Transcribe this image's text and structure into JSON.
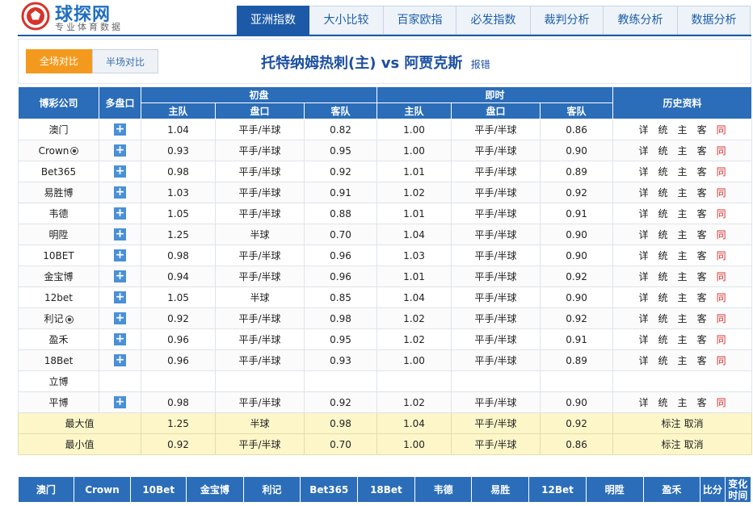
{
  "logo": {
    "name": "球探网",
    "subtitle": "专业体育数据",
    "icon": "soccer-ball-logo"
  },
  "nav": {
    "tabs": [
      {
        "label": "亚洲指数",
        "active": true
      },
      {
        "label": "大小比较",
        "active": false
      },
      {
        "label": "百家欧指",
        "active": false
      },
      {
        "label": "必发指数",
        "active": false
      },
      {
        "label": "裁判分析",
        "active": false
      },
      {
        "label": "教练分析",
        "active": false
      },
      {
        "label": "数据分析",
        "active": false
      }
    ]
  },
  "compare": {
    "full_label": "全场对比",
    "half_label": "半场对比"
  },
  "match": {
    "title": "托特纳姆热刺(主) vs 阿贾克斯",
    "report": "报错"
  },
  "table": {
    "headers": {
      "company": "博彩公司",
      "multi": "多盘口",
      "initial": "初盘",
      "live": "即时",
      "history": "历史资料",
      "home": "主队",
      "line": "盘口",
      "away": "客队"
    },
    "history_links": [
      "详",
      "统",
      "主",
      "客",
      "同"
    ],
    "rows": [
      {
        "company": "澳门",
        "ball": false,
        "plus": true,
        "i_home": "1.04",
        "i_line": "平手/半球",
        "i_away": "0.82",
        "l_home": "1.00",
        "l_line": "平手/半球",
        "l_away": "0.86",
        "hist": true
      },
      {
        "company": "Crown",
        "ball": true,
        "plus": true,
        "i_home": "0.93",
        "i_line": "平手/半球",
        "i_away": "0.95",
        "l_home": "1.00",
        "l_line": "平手/半球",
        "l_away": "0.90",
        "hist": true
      },
      {
        "company": "Bet365",
        "ball": false,
        "plus": true,
        "i_home": "0.98",
        "i_line": "平手/半球",
        "i_away": "0.92",
        "l_home": "1.01",
        "l_line": "平手/半球",
        "l_away": "0.89",
        "hist": true
      },
      {
        "company": "易胜博",
        "ball": false,
        "plus": true,
        "i_home": "1.03",
        "i_line": "平手/半球",
        "i_away": "0.91",
        "l_home": "1.02",
        "l_line": "平手/半球",
        "l_away": "0.92",
        "hist": true
      },
      {
        "company": "韦德",
        "ball": false,
        "plus": true,
        "i_home": "1.05",
        "i_line": "平手/半球",
        "i_away": "0.88",
        "l_home": "1.01",
        "l_line": "平手/半球",
        "l_away": "0.91",
        "hist": true
      },
      {
        "company": "明陞",
        "ball": false,
        "plus": true,
        "i_home": "1.25",
        "i_line": "半球",
        "i_away": "0.70",
        "l_home": "1.04",
        "l_line": "平手/半球",
        "l_away": "0.90",
        "hist": true
      },
      {
        "company": "10BET",
        "ball": false,
        "plus": true,
        "i_home": "0.98",
        "i_line": "平手/半球",
        "i_away": "0.96",
        "l_home": "1.03",
        "l_line": "平手/半球",
        "l_away": "0.90",
        "hist": true
      },
      {
        "company": "金宝博",
        "ball": false,
        "plus": true,
        "i_home": "0.94",
        "i_line": "平手/半球",
        "i_away": "0.96",
        "l_home": "1.01",
        "l_line": "平手/半球",
        "l_away": "0.92",
        "hist": true
      },
      {
        "company": "12bet",
        "ball": false,
        "plus": true,
        "i_home": "1.05",
        "i_line": "半球",
        "i_away": "0.85",
        "l_home": "1.04",
        "l_line": "平手/半球",
        "l_away": "0.90",
        "hist": true
      },
      {
        "company": "利记",
        "ball": true,
        "plus": true,
        "i_home": "0.92",
        "i_line": "平手/半球",
        "i_away": "0.98",
        "l_home": "1.02",
        "l_line": "平手/半球",
        "l_away": "0.92",
        "hist": true
      },
      {
        "company": "盈禾",
        "ball": false,
        "plus": true,
        "i_home": "0.96",
        "i_line": "平手/半球",
        "i_away": "0.95",
        "l_home": "1.02",
        "l_line": "平手/半球",
        "l_away": "0.91",
        "hist": true
      },
      {
        "company": "18Bet",
        "ball": false,
        "plus": true,
        "i_home": "0.96",
        "i_line": "平手/半球",
        "i_away": "0.93",
        "l_home": "1.00",
        "l_line": "平手/半球",
        "l_away": "0.89",
        "hist": true
      },
      {
        "company": "立博",
        "ball": false,
        "plus": false,
        "i_home": "",
        "i_line": "",
        "i_away": "",
        "l_home": "",
        "l_line": "",
        "l_away": "",
        "hist": false
      },
      {
        "company": "平博",
        "ball": false,
        "plus": true,
        "i_home": "0.98",
        "i_line": "平手/半球",
        "i_away": "0.92",
        "l_home": "1.02",
        "l_line": "平手/半球",
        "l_away": "0.90",
        "hist": true
      }
    ],
    "summary": [
      {
        "label": "最大值",
        "i_home": "1.25",
        "i_line": "半球",
        "i_away": "0.98",
        "l_home": "1.04",
        "l_line": "平手/半球",
        "l_away": "0.92",
        "mark": "标注",
        "cancel": "取消"
      },
      {
        "label": "最小值",
        "i_home": "0.92",
        "i_line": "平手/半球",
        "i_away": "0.70",
        "l_home": "1.00",
        "l_line": "平手/半球",
        "l_away": "0.86",
        "mark": "标注",
        "cancel": "取消"
      }
    ]
  },
  "bottom": {
    "headers": [
      "澳门",
      "Crown",
      "10Bet",
      "金宝博",
      "利记",
      "Bet365",
      "18Bet",
      "韦德",
      "易胜",
      "12Bet",
      "明陞",
      "盈禾",
      "比分",
      "变化时间"
    ]
  }
}
